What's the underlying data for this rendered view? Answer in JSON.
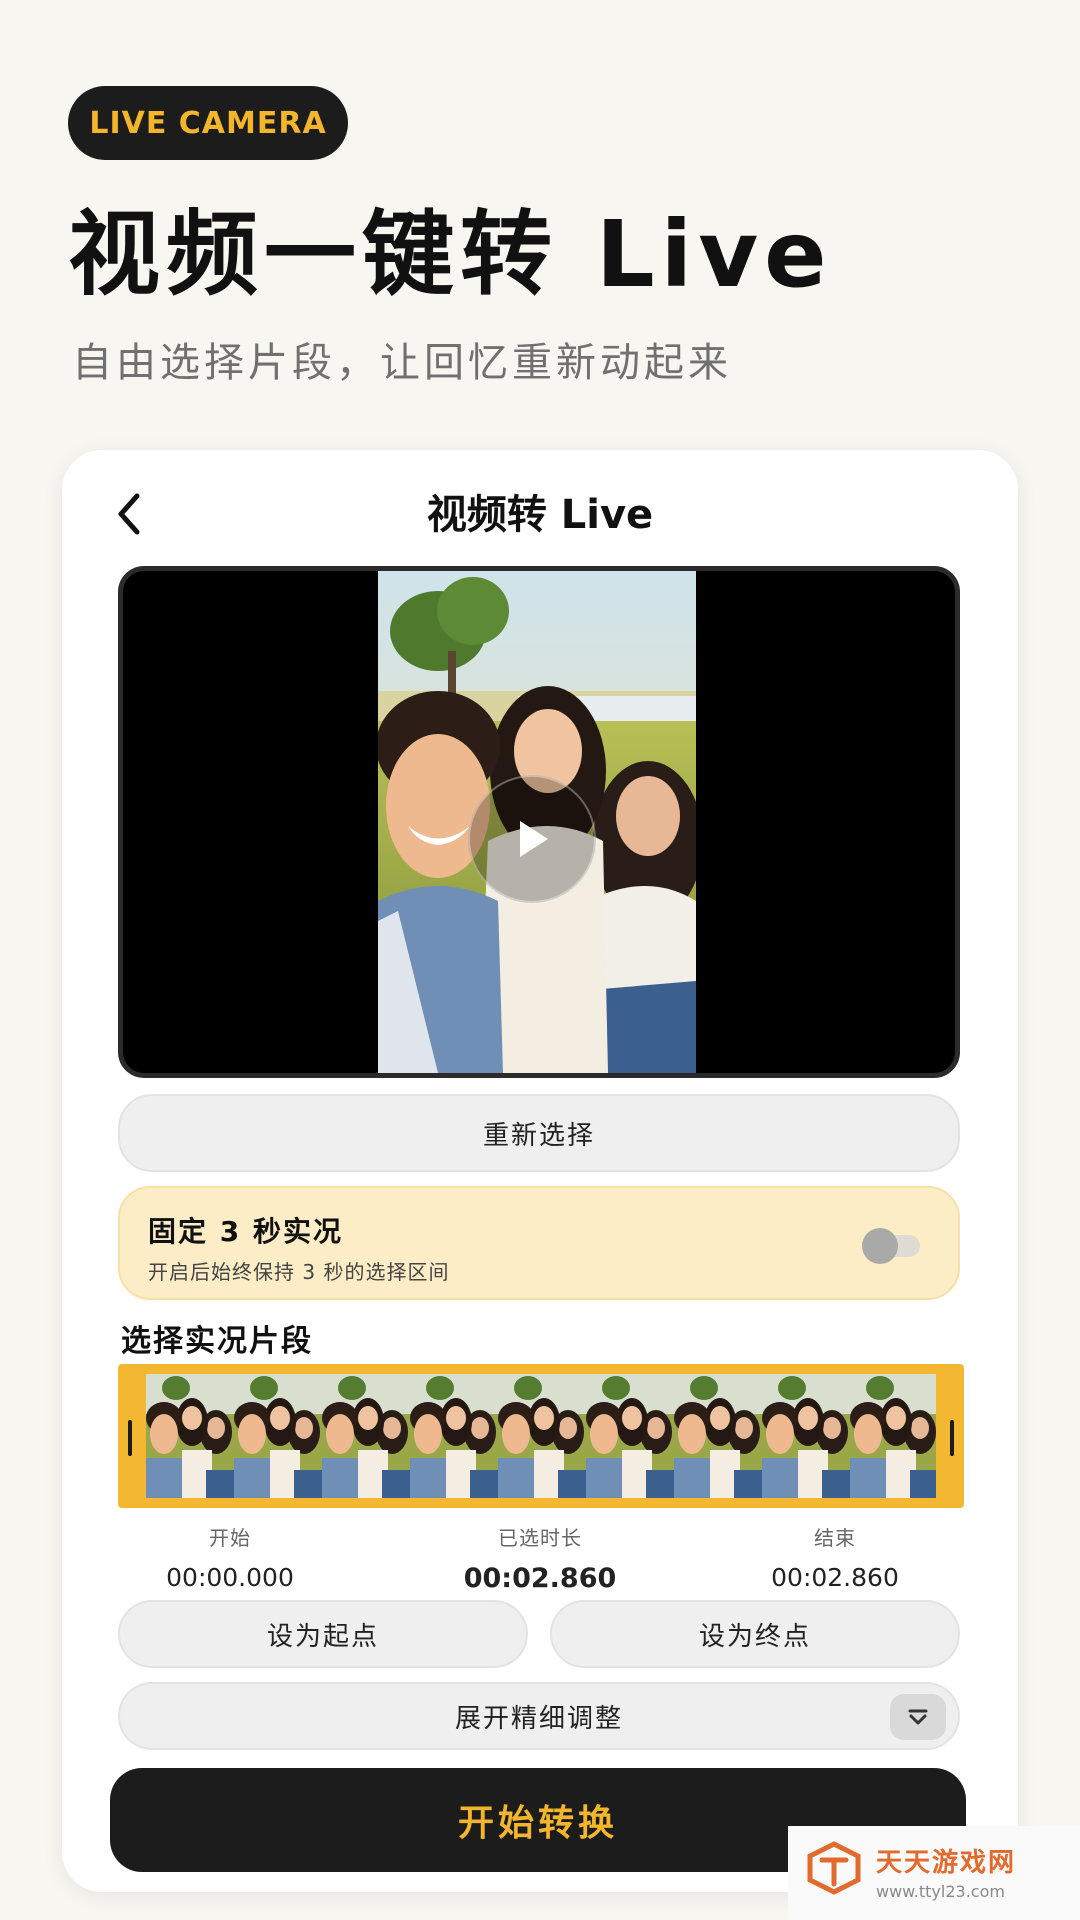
{
  "hero": {
    "badge": "LIVE CAMERA",
    "title": "视频一键转 Live",
    "subtitle": "自由选择片段，让回忆重新动起来"
  },
  "screen": {
    "title": "视频转 Live",
    "back_icon": "chevron-left-icon"
  },
  "player": {
    "play_icon": "play-icon"
  },
  "reselect_label": "重新选择",
  "fixed_mode": {
    "title": "固定 3 秒实况",
    "description": "开启后始终保持 3 秒的选择区间",
    "enabled": false
  },
  "clip_section": {
    "title": "选择实况片段",
    "start_label": "开始",
    "start_value": "00:00.000",
    "duration_label": "已选时长",
    "duration_value": "00:02.860",
    "end_label": "结束",
    "end_value": "00:02.860"
  },
  "actions": {
    "set_start": "设为起点",
    "set_end": "设为终点",
    "expand": "展开精细调整",
    "expand_icon": "chevron-down-icon",
    "convert": "开始转换"
  },
  "watermark": {
    "name": "天天游戏网",
    "url": "www.ttyl23.com"
  },
  "colors": {
    "accent": "#f2b52b",
    "dark": "#1c1c1c",
    "panel": "#fdedc6",
    "timeline": "#f4b731"
  }
}
